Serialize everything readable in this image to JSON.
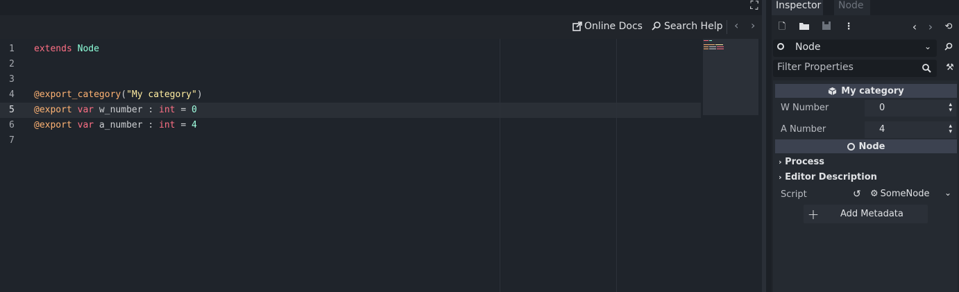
{
  "script_toolbar": {
    "online_docs_label": "Online Docs",
    "search_help_label": "Search Help"
  },
  "editor": {
    "line_numbers": [
      "1",
      "2",
      "3",
      "4",
      "5",
      "6",
      "7"
    ],
    "lines": [
      {
        "parts": [
          {
            "t": "extends",
            "c": "kw"
          },
          {
            "t": " "
          },
          {
            "t": "Node",
            "c": "ty"
          }
        ]
      },
      {
        "parts": []
      },
      {
        "parts": []
      },
      {
        "parts": [
          {
            "t": "@export_category",
            "c": "an"
          },
          {
            "t": "("
          },
          {
            "t": "\"My category\"",
            "c": "str"
          },
          {
            "t": ")"
          }
        ]
      },
      {
        "parts": [
          {
            "t": "@export",
            "c": "an"
          },
          {
            "t": " "
          },
          {
            "t": "var",
            "c": "kw"
          },
          {
            "t": " w_number : "
          },
          {
            "t": "int",
            "c": "kw"
          },
          {
            "t": " = "
          },
          {
            "t": "0",
            "c": "num"
          }
        ]
      },
      {
        "parts": [
          {
            "t": "@export",
            "c": "an"
          },
          {
            "t": " "
          },
          {
            "t": "var",
            "c": "kw"
          },
          {
            "t": " a_number : "
          },
          {
            "t": "int",
            "c": "kw"
          },
          {
            "t": " = "
          },
          {
            "t": "4",
            "c": "num"
          }
        ]
      },
      {
        "parts": []
      }
    ],
    "current_line": "5"
  },
  "inspector": {
    "tabs": [
      "Inspector",
      "Node"
    ],
    "active_tab": "Inspector",
    "object_name": "Node",
    "filter_placeholder": "Filter Properties",
    "category_title": "My category",
    "properties": [
      {
        "label": "W Number",
        "value": "0"
      },
      {
        "label": "A Number",
        "value": "4"
      }
    ],
    "node_section_title": "Node",
    "subsections": [
      "Process",
      "Editor Description"
    ],
    "script_label": "Script",
    "script_value": "SomeNode",
    "add_metadata_label": "Add Metadata"
  },
  "colors": {
    "keyword": "#ff7085",
    "type": "#8effda",
    "annotation": "#ffb373",
    "string": "#ffeda1",
    "number": "#a1ffe0"
  }
}
